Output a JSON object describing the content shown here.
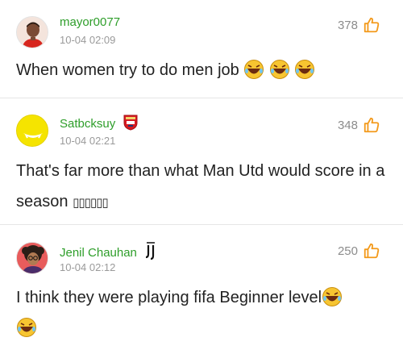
{
  "comments": [
    {
      "username": "mayor0077",
      "timestamp": "10-04 02:09",
      "likes": "378",
      "text": "When women try to do men job",
      "emoji_count": 3,
      "avatar_icon": "football-player-avatar-icon"
    },
    {
      "username": "Satbcksuy",
      "timestamp": "10-04 02:21",
      "likes": "348",
      "text": "That's far more than what Man Utd would score in a season ",
      "tofu": "▯▯▯▯▯▯",
      "badge_icon": "arsenal-crest-icon",
      "avatar_icon": "yellow-face-avatar-icon"
    },
    {
      "username": "Jenil Chauhan",
      "timestamp": "10-04 02:12",
      "likes": "250",
      "text": "I think they were playing fifa Beginner level",
      "emoji_count": 2,
      "badge_icon": "juventus-logo-icon",
      "avatar_icon": "curly-hair-avatar-icon"
    }
  ],
  "colors": {
    "username": "#2e9e2a",
    "like_icon": "#f39a1c",
    "divider": "#e6e6e6"
  }
}
